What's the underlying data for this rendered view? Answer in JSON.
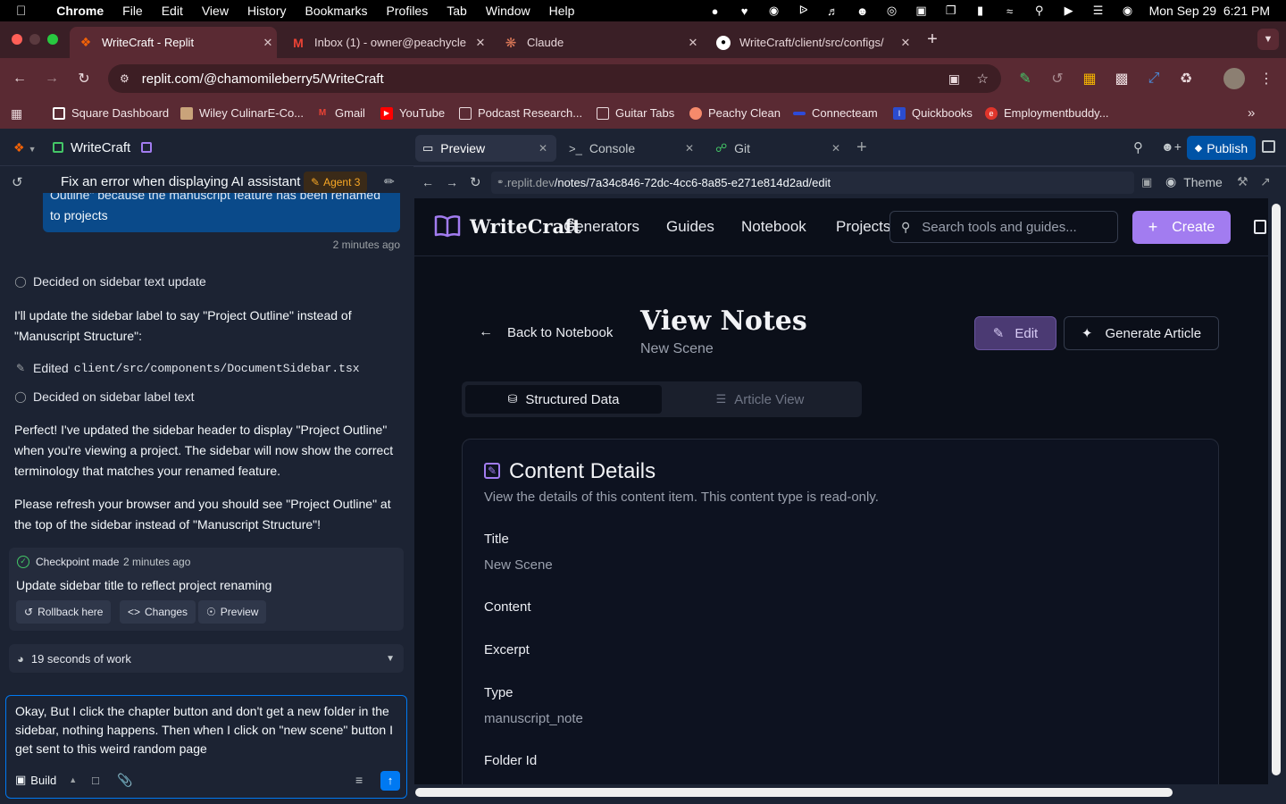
{
  "menubar": {
    "app_name": "Chrome",
    "items": [
      "File",
      "Edit",
      "View",
      "History",
      "Bookmarks",
      "Profiles",
      "Tab",
      "Window",
      "Help"
    ],
    "datetime": "Mon Sep 29  6:21 PM"
  },
  "browser_tabs": [
    {
      "title": "WriteCraft - Replit",
      "icon": "replit-icon",
      "active": true
    },
    {
      "title": "Inbox (1) - owner@peachycle",
      "icon": "gmail-icon",
      "active": false
    },
    {
      "title": "Claude",
      "icon": "claude-icon",
      "active": false
    },
    {
      "title": "WriteCraft/client/src/configs/",
      "icon": "github-icon",
      "active": false
    }
  ],
  "address": {
    "url": "replit.com/@chamomileberry5/WriteCraft"
  },
  "bookmarks": [
    {
      "label": "Square Dashboard",
      "color": "#ffffff"
    },
    {
      "label": "Wiley CulinarE-Co...",
      "color": "#c9a37a"
    },
    {
      "label": "Gmail",
      "color": "#ea4335"
    },
    {
      "label": "YouTube",
      "color": "#ff0000"
    },
    {
      "label": "Podcast Research...",
      "color": "folder"
    },
    {
      "label": "Guitar Tabs",
      "color": "folder"
    },
    {
      "label": "Peachy Clean",
      "color": "#f58a6b"
    },
    {
      "label": "Connecteam",
      "color": "#2d4ad8"
    },
    {
      "label": "Quickbooks",
      "color": "#2b4ccf"
    },
    {
      "label": "Employmentbuddy...",
      "color": "#e0352b"
    }
  ],
  "replit": {
    "repl_name": "WriteCraft",
    "chat_title": "Fix an error when displaying AI assistant ...",
    "agent_badge": "Agent 3",
    "workspace_tabs": [
      "Preview",
      "Console",
      "Git"
    ],
    "publish_label": "Publish",
    "preview_url_host": ".replit.dev",
    "preview_url_path": "/notes/7a34c846-72dc-4cc6-8a85-e271e814d2ad/edit",
    "theme_label": "Theme"
  },
  "chat": {
    "user_bubble_top": "Outline\" because the manuscript feature has been renamed",
    "user_bubble_bottom": "to projects",
    "bubble_time": "2 minutes ago",
    "decided_1": "Decided on sidebar text update",
    "msg_1": "I'll update the sidebar label to say \"Project Outline\" instead of \"Manuscript Structure\":",
    "edited_prefix": "Edited",
    "edited_file": "client/src/components/DocumentSidebar.tsx",
    "decided_2": "Decided on sidebar label text",
    "msg_2": "Perfect! I've updated the sidebar header to display \"Project Outline\" when you're viewing a project. The sidebar will now show the correct terminology that matches your renamed feature.",
    "msg_3": "Please refresh your browser and you should see \"Project Outline\" at the top of the sidebar instead of \"Manuscript Structure\"!",
    "checkpoint_label": "Checkpoint made",
    "checkpoint_time": "2 minutes ago",
    "checkpoint_title": "Update sidebar title to reflect project renaming",
    "rollback": "Rollback here",
    "changes": "Changes",
    "preview": "Preview",
    "work_time": "19 seconds of work",
    "input_text": "Okay, But I click the chapter button and don't get a new folder in the sidebar, nothing happens. Then when I click on \"new scene\" button I get sent to this weird random page",
    "build_label": "Build"
  },
  "app": {
    "logo": "WriteCraft",
    "nav": [
      "Generators",
      "Guides",
      "Notebook",
      "Projects"
    ],
    "search_placeholder": "Search tools and guides...",
    "create_label": "Create",
    "back_label": "Back to Notebook",
    "page_title": "View Notes",
    "page_subtitle": "New Scene",
    "edit_label": "Edit",
    "generate_label": "Generate Article",
    "view_tabs": [
      "Structured Data",
      "Article View"
    ],
    "card_title": "Content Details",
    "card_desc": "View the details of this content item. This content type is read-only.",
    "fields": [
      {
        "label": "Title",
        "value": "New Scene"
      },
      {
        "label": "Content",
        "value": ""
      },
      {
        "label": "Excerpt",
        "value": ""
      },
      {
        "label": "Type",
        "value": "manuscript_note"
      },
      {
        "label": "Folder Id",
        "value": ""
      }
    ],
    "accent": "#a27cf0"
  }
}
